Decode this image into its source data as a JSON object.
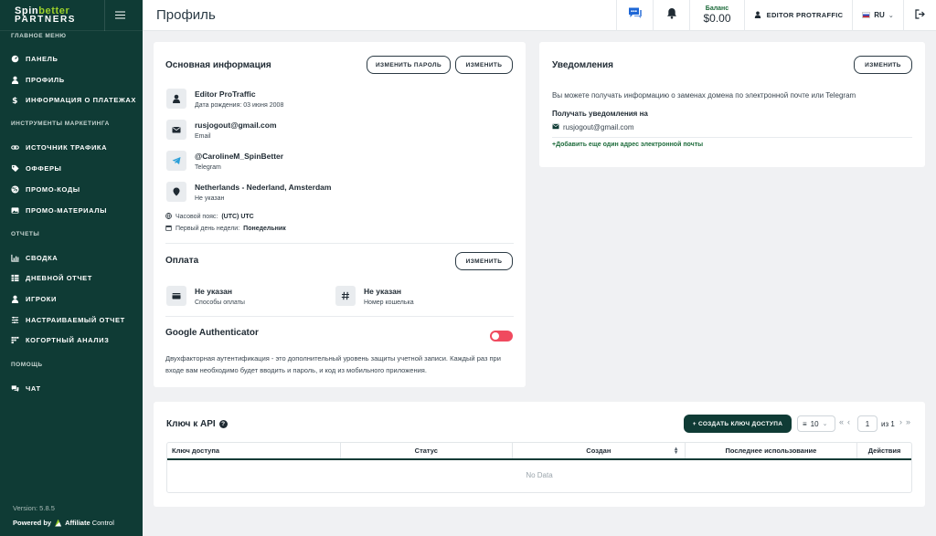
{
  "brand": {
    "line1_a": "Spin",
    "line1_b": "better",
    "line2": "PARTNERS"
  },
  "sidebar": {
    "sections": [
      {
        "title": "ГЛАВНОЕ МЕНЮ"
      },
      {
        "title": "ИНСТРУМЕНТЫ МАРКЕТИНГА"
      },
      {
        "title": "ОТЧЕТЫ"
      },
      {
        "title": "ПОМОЩЬ"
      }
    ],
    "items": [
      {
        "label": "ПАНЕЛЬ",
        "icon": "dashboard-icon"
      },
      {
        "label": "ПРОФИЛЬ",
        "icon": "user-icon"
      },
      {
        "label": "ИНФОРМАЦИЯ О ПЛАТЕЖАХ",
        "icon": "dollar-icon"
      },
      {
        "label": "ИСТОЧНИК ТРАФИКА",
        "icon": "link-icon"
      },
      {
        "label": "ОФФЕРЫ",
        "icon": "tag-icon"
      },
      {
        "label": "ПРОМО-КОДЫ",
        "icon": "percent-icon"
      },
      {
        "label": "ПРОМО-МАТЕРИАЛЫ",
        "icon": "image-icon"
      },
      {
        "label": "СВОДКА",
        "icon": "bar-chart-icon"
      },
      {
        "label": "ДНЕВНОЙ ОТЧЕТ",
        "icon": "table-icon"
      },
      {
        "label": "ИГРОКИ",
        "icon": "user-icon"
      },
      {
        "label": "НАСТРАИВАЕМЫЙ ОТЧЕТ",
        "icon": "sliders-icon"
      },
      {
        "label": "КОГОРТНЫЙ АНАЛИЗ",
        "icon": "cohort-icon"
      },
      {
        "label": "ЧАТ",
        "icon": "chat-icon"
      }
    ],
    "version": "Version: 5.8.5",
    "powered_by": "Powered by",
    "powered_brand_a": "Affiliate",
    "powered_brand_b": "Control"
  },
  "header": {
    "title": "Профиль",
    "balance_label": "Баланс",
    "balance_value": "$0.00",
    "user_name": "EDITOR PROTRAFFIC",
    "language": "RU"
  },
  "basic_info": {
    "title": "Основная информация",
    "change_password_label": "ИЗМЕНИТЬ ПАРОЛЬ",
    "edit_label": "ИЗМЕНИТЬ",
    "name": "Editor ProTraffic",
    "birth": "Дата рождения: 03 июня 2008",
    "email": "rusjogout@gmail.com",
    "email_label": "Email",
    "telegram": "@CarolineM_SpinBetter",
    "telegram_label": "Telegram",
    "location": "Netherlands - Nederland, Amsterdam",
    "location_label": "Не указан",
    "timezone_label": "Часовой пояс:",
    "timezone_value": "(UTC) UTC",
    "week_start_label": "Первый день недели:",
    "week_start_value": "Понедельник"
  },
  "payment": {
    "title": "Оплата",
    "edit_label": "ИЗМЕНИТЬ",
    "method_value": "Не указан",
    "method_label": "Способы оплаты",
    "wallet_value": "Не указан",
    "wallet_label": "Номер кошелька"
  },
  "two_factor": {
    "title": "Google Authenticator",
    "enabled": false,
    "description": "Двухфакторная аутентификация - это дополнительный уровень защиты учетной записи. Каждый раз при входе вам необходимо будет вводить и пароль, и код из мобильного приложения."
  },
  "notifications": {
    "title": "Уведомления",
    "edit_label": "ИЗМЕНИТЬ",
    "description": "Вы можете получать информацию о заменах домена по электронной почте или Telegram",
    "receive_label": "Получать уведомления на",
    "email": "rusjogout@gmail.com",
    "add_link": "+Добавить еще один адрес электронной почты"
  },
  "api": {
    "title": "Ключ к API",
    "create_label": "+ СОЗДАТЬ КЛЮЧ ДОСТУПА",
    "page_size": "10",
    "page": "1",
    "of_pages": "из 1",
    "columns": [
      "Ключ доступа",
      "Статус",
      "Создан",
      "Последнее использование",
      "Действия"
    ],
    "empty": "No Data"
  },
  "colors": {
    "sidebar": "#0f3b35",
    "accent": "#9bd02b",
    "toggle_off": "#f04a5f"
  }
}
